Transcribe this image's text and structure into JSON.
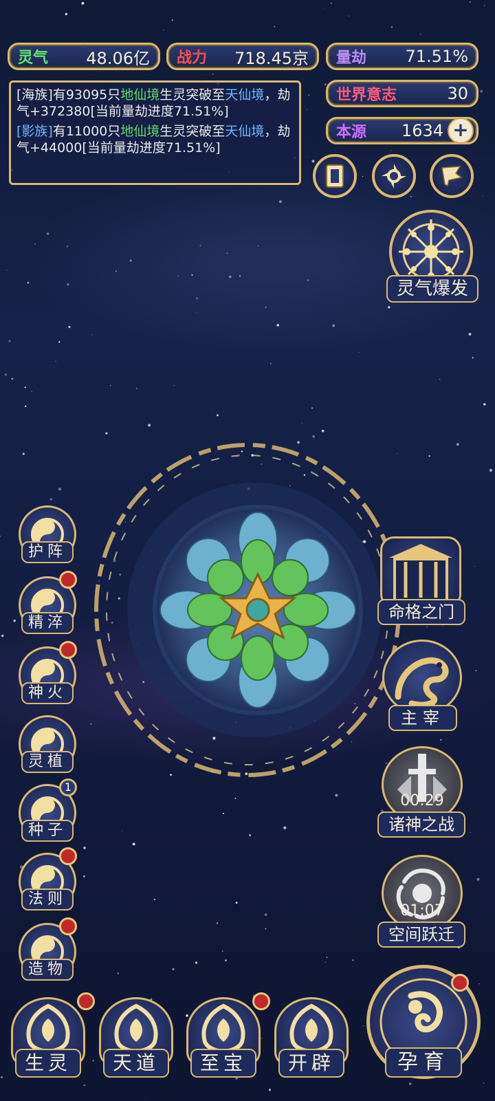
{
  "stats": {
    "lingqi": {
      "label": "灵气",
      "value": "48.06亿",
      "label_color": "#67e46a"
    },
    "zhanli": {
      "label": "战力",
      "value": "718.45京",
      "label_color": "#ff4d4d"
    },
    "liangjie": {
      "label": "量劫",
      "value": "71.51%",
      "label_color": "#b98cf0"
    },
    "shijie": {
      "label": "世界意志",
      "value": "30",
      "label_color": "#ff5a7a"
    },
    "benyuan": {
      "label": "本源",
      "value": "1634",
      "label_color": "#d06cff",
      "plus": "+"
    }
  },
  "log": [
    {
      "race": "[海族]",
      "t1": "有93095只",
      "realm1": "地仙境",
      "t2": "生灵突破至",
      "realm2": "天仙境",
      "t3": "，劫气+372380[当前量劫进度71.51%]"
    },
    {
      "race": "[影族]",
      "t1": "有11000只",
      "realm1": "地仙境",
      "t2": "生灵突破至",
      "realm2": "天仙境",
      "t3": "，劫气+44000[当前量劫进度71.51%]"
    }
  ],
  "burst": {
    "label": "灵气爆发"
  },
  "left_menu": [
    {
      "label": "护阵",
      "icon": "yin-yang-icon",
      "badge": false
    },
    {
      "label": "精淬",
      "icon": "lotus-flame-icon",
      "badge": true
    },
    {
      "label": "神火",
      "icon": "fire-icon",
      "badge": true
    },
    {
      "label": "灵植",
      "icon": "plant-icon",
      "badge": false
    },
    {
      "label": "种子",
      "icon": "seed-icon",
      "badge": "1"
    },
    {
      "label": "法则",
      "icon": "law-icon",
      "badge": true
    },
    {
      "label": "造物",
      "icon": "diamond-icon",
      "badge": true
    }
  ],
  "right_menu": [
    {
      "label": "命格之门",
      "icon": "gate-icon"
    },
    {
      "label": "主宰",
      "icon": "dragon-icon"
    },
    {
      "label": "诸神之战",
      "icon": "sword-icon",
      "timer": "00:29"
    },
    {
      "label": "空间跃迁",
      "icon": "vortex-icon",
      "timer": "01:07"
    }
  ],
  "bottom_menu": [
    {
      "label": "生灵",
      "icon": "creature-icon",
      "badge": true
    },
    {
      "label": "天道",
      "icon": "heaven-icon",
      "badge": false
    },
    {
      "label": "至宝",
      "icon": "treasure-icon",
      "badge": true
    },
    {
      "label": "开辟",
      "icon": "create-icon",
      "badge": false
    }
  ],
  "yunyu": {
    "label": "孕育",
    "badge": true
  }
}
